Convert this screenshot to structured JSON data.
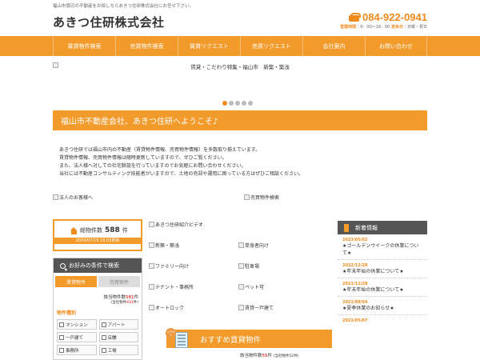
{
  "header": {
    "tagline": "福山市周辺の不動産をお探しならあきつ住研株式会社にお任せ下さい。",
    "company": "あきつ住研株式会社",
    "phone": "084-922-0941",
    "hours_label": "営業時間",
    "hours_value": "｜9：00～18：00",
    "holiday_label": "定休日",
    "holiday_value": "｜日曜・祝日"
  },
  "nav": [
    {
      "label": "賃貸物件検索"
    },
    {
      "label": "売買物件検索"
    },
    {
      "label": "賃貸リクエスト"
    },
    {
      "label": "売買リクエスト"
    },
    {
      "label": "会社案内"
    },
    {
      "label": "お問い合わせ"
    }
  ],
  "banner": {
    "alt": "賃貸・こだわり特集・福山市　新築・築浅"
  },
  "carousel": {
    "count": 5,
    "active": 0
  },
  "welcome": "福山市不動産会社、あきつ住研へようこそ♪",
  "intro": [
    "あきつ住研では福山市内の不動産（賃貸物件情報、売買物件情報）を多数取り揃えています。",
    "賃貸物件情報、売買物件情報は随時更新していますので、ぜひご覧ください。",
    "また、法人様へ対しての社宅斡旋を行っていますのでお気軽にお問い合わせください。",
    "当社には不動産コンサルティング技能者がいますので、土地の売却や運用に困っている方はぜひご相談ください。"
  ],
  "links": {
    "corporate": "法人のお客様へ",
    "sale_search": "売買物件検索",
    "video": "あきつ住研紹介ビデオ",
    "new_built": "新築・築浅",
    "single": "単身者向け",
    "family": "ファミリー向け",
    "parking": "駐車場",
    "tenant": "テナント・事務所",
    "pet": "ペット可",
    "autolock": "オートロック",
    "house": "賃貸一戸建て"
  },
  "stock": {
    "label": "総物件数",
    "count": "588",
    "unit": "件",
    "updated": "2024/07/19 19:03更新"
  },
  "search": {
    "title": "お好みの条件で検索",
    "tabs": [
      "賃貸物件",
      "売買物件"
    ],
    "hit_label": "該当物件数",
    "hit_count": "581",
    "hit_unit": "件",
    "hit_sub_label": "(当社物件",
    "hit_sub_count": "431",
    "hit_sub_unit": "件)",
    "category_title": "物件種別",
    "categories": [
      "マンション",
      "アパート",
      "一戸建て",
      "店舗",
      "事務所",
      "工場"
    ]
  },
  "recommend": {
    "tag": "イチオシ",
    "title": "おすすめ賃貸物件",
    "count_label": "該当物件数",
    "count": "55",
    "unit": "件",
    "sub": "(当社物件52件)"
  },
  "news": {
    "title": "新着情報",
    "items": [
      {
        "date": "2023/05/02",
        "title": "★ゴールデンウイークの休業について★"
      },
      {
        "date": "2022/12/28",
        "title": "★年末年始の休業について★"
      },
      {
        "date": "2021/12/28",
        "title": "★年末年始の休業について★"
      },
      {
        "date": "2021/08/04",
        "title": "★夏季休業のお知らせ★"
      },
      {
        "date": "2021/05/07",
        "title": ""
      }
    ]
  },
  "colors": {
    "accent": "#f29a2a",
    "dark": "#555555",
    "red": "#dd0000"
  }
}
